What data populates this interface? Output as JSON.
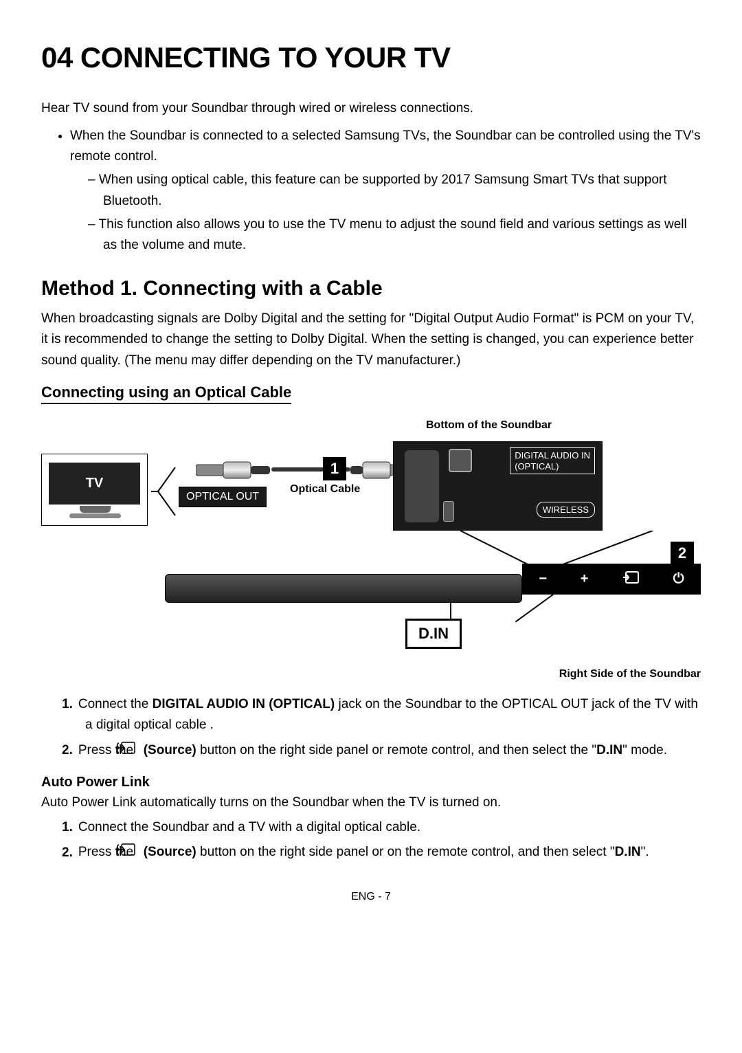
{
  "title": "04   CONNECTING TO YOUR TV",
  "intro": "Hear TV sound from your Soundbar through wired or wireless connections.",
  "bullet": "When the Soundbar is connected to a selected Samsung TVs, the Soundbar can be controlled using the TV's remote control.",
  "dash1": "When using optical cable, this feature can be supported by 2017 Samsung Smart TVs that support Bluetooth.",
  "dash2": "This function also allows you to use the TV menu to adjust the sound field and various settings as well as the volume and mute.",
  "method1_heading": "Method 1. Connecting with a Cable",
  "method1_para": "When broadcasting signals are Dolby Digital and the setting for \"Digital Output Audio Format\" is PCM on your TV, it is recommended to change the setting to Dolby Digital. When the setting is changed, you can experience better sound quality. (The menu may differ depending on the TV manufacturer.)",
  "sub_heading": "Connecting using an Optical Cable",
  "diagram": {
    "top_label": "Bottom of the Soundbar",
    "bottom_label": "Right Side of the Soundbar",
    "tv": "TV",
    "optical_out": "OPTICAL OUT",
    "cable": "Optical Cable",
    "num1": "1",
    "num2": "2",
    "port_top": "DIGITAL AUDIO IN\n(OPTICAL)",
    "port_bottom": "WIRELESS",
    "din": "D.IN",
    "side_minus": "−",
    "side_plus": "+",
    "side_power": "⏻"
  },
  "step1_num": "1.",
  "step1_a": "Connect the ",
  "step1_b": "DIGITAL AUDIO IN (OPTICAL)",
  "step1_c": " jack on the Soundbar to the OPTICAL OUT jack of the TV with a digital optical cable .",
  "step2_num": "2.",
  "step2_a": "Press the ",
  "step2_b": "(Source)",
  "step2_c": " button on the right side panel or remote control, and then select the \"",
  "step2_d": "D.IN",
  "step2_e": "\" mode.",
  "apl_heading": "Auto Power Link",
  "apl_para": "Auto Power Link automatically turns on the Soundbar when the TV is turned on.",
  "apl1_num": "1.",
  "apl1": "Connect the Soundbar and a TV with a digital optical cable.",
  "apl2_num": "2.",
  "apl2_a": "Press the ",
  "apl2_b": "(Source)",
  "apl2_c": " button on the right side panel or on the remote control, and then select \"",
  "apl2_d": "D.IN",
  "apl2_e": "\".",
  "page_num": "ENG - 7"
}
